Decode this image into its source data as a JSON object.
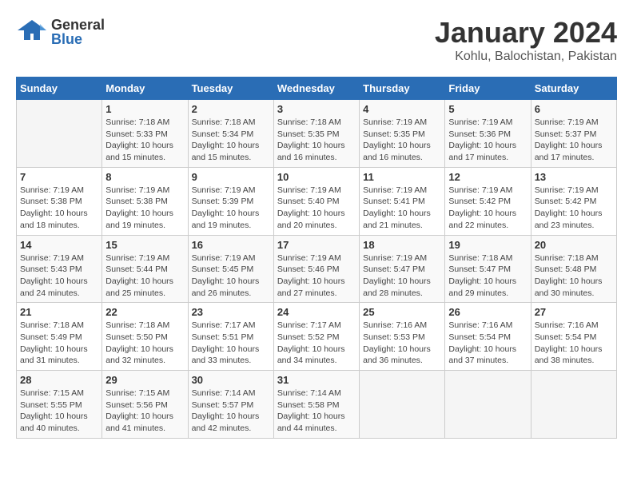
{
  "header": {
    "logo_general": "General",
    "logo_blue": "Blue",
    "main_title": "January 2024",
    "subtitle": "Kohlu, Balochistan, Pakistan"
  },
  "columns": [
    "Sunday",
    "Monday",
    "Tuesday",
    "Wednesday",
    "Thursday",
    "Friday",
    "Saturday"
  ],
  "weeks": [
    [
      {
        "day": "",
        "content": ""
      },
      {
        "day": "1",
        "content": "Sunrise: 7:18 AM\nSunset: 5:33 PM\nDaylight: 10 hours and 15 minutes."
      },
      {
        "day": "2",
        "content": "Sunrise: 7:18 AM\nSunset: 5:34 PM\nDaylight: 10 hours and 15 minutes."
      },
      {
        "day": "3",
        "content": "Sunrise: 7:18 AM\nSunset: 5:35 PM\nDaylight: 10 hours and 16 minutes."
      },
      {
        "day": "4",
        "content": "Sunrise: 7:19 AM\nSunset: 5:35 PM\nDaylight: 10 hours and 16 minutes."
      },
      {
        "day": "5",
        "content": "Sunrise: 7:19 AM\nSunset: 5:36 PM\nDaylight: 10 hours and 17 minutes."
      },
      {
        "day": "6",
        "content": "Sunrise: 7:19 AM\nSunset: 5:37 PM\nDaylight: 10 hours and 17 minutes."
      }
    ],
    [
      {
        "day": "7",
        "content": "Sunrise: 7:19 AM\nSunset: 5:38 PM\nDaylight: 10 hours and 18 minutes."
      },
      {
        "day": "8",
        "content": "Sunrise: 7:19 AM\nSunset: 5:38 PM\nDaylight: 10 hours and 19 minutes."
      },
      {
        "day": "9",
        "content": "Sunrise: 7:19 AM\nSunset: 5:39 PM\nDaylight: 10 hours and 19 minutes."
      },
      {
        "day": "10",
        "content": "Sunrise: 7:19 AM\nSunset: 5:40 PM\nDaylight: 10 hours and 20 minutes."
      },
      {
        "day": "11",
        "content": "Sunrise: 7:19 AM\nSunset: 5:41 PM\nDaylight: 10 hours and 21 minutes."
      },
      {
        "day": "12",
        "content": "Sunrise: 7:19 AM\nSunset: 5:42 PM\nDaylight: 10 hours and 22 minutes."
      },
      {
        "day": "13",
        "content": "Sunrise: 7:19 AM\nSunset: 5:42 PM\nDaylight: 10 hours and 23 minutes."
      }
    ],
    [
      {
        "day": "14",
        "content": "Sunrise: 7:19 AM\nSunset: 5:43 PM\nDaylight: 10 hours and 24 minutes."
      },
      {
        "day": "15",
        "content": "Sunrise: 7:19 AM\nSunset: 5:44 PM\nDaylight: 10 hours and 25 minutes."
      },
      {
        "day": "16",
        "content": "Sunrise: 7:19 AM\nSunset: 5:45 PM\nDaylight: 10 hours and 26 minutes."
      },
      {
        "day": "17",
        "content": "Sunrise: 7:19 AM\nSunset: 5:46 PM\nDaylight: 10 hours and 27 minutes."
      },
      {
        "day": "18",
        "content": "Sunrise: 7:19 AM\nSunset: 5:47 PM\nDaylight: 10 hours and 28 minutes."
      },
      {
        "day": "19",
        "content": "Sunrise: 7:18 AM\nSunset: 5:47 PM\nDaylight: 10 hours and 29 minutes."
      },
      {
        "day": "20",
        "content": "Sunrise: 7:18 AM\nSunset: 5:48 PM\nDaylight: 10 hours and 30 minutes."
      }
    ],
    [
      {
        "day": "21",
        "content": "Sunrise: 7:18 AM\nSunset: 5:49 PM\nDaylight: 10 hours and 31 minutes."
      },
      {
        "day": "22",
        "content": "Sunrise: 7:18 AM\nSunset: 5:50 PM\nDaylight: 10 hours and 32 minutes."
      },
      {
        "day": "23",
        "content": "Sunrise: 7:17 AM\nSunset: 5:51 PM\nDaylight: 10 hours and 33 minutes."
      },
      {
        "day": "24",
        "content": "Sunrise: 7:17 AM\nSunset: 5:52 PM\nDaylight: 10 hours and 34 minutes."
      },
      {
        "day": "25",
        "content": "Sunrise: 7:16 AM\nSunset: 5:53 PM\nDaylight: 10 hours and 36 minutes."
      },
      {
        "day": "26",
        "content": "Sunrise: 7:16 AM\nSunset: 5:54 PM\nDaylight: 10 hours and 37 minutes."
      },
      {
        "day": "27",
        "content": "Sunrise: 7:16 AM\nSunset: 5:54 PM\nDaylight: 10 hours and 38 minutes."
      }
    ],
    [
      {
        "day": "28",
        "content": "Sunrise: 7:15 AM\nSunset: 5:55 PM\nDaylight: 10 hours and 40 minutes."
      },
      {
        "day": "29",
        "content": "Sunrise: 7:15 AM\nSunset: 5:56 PM\nDaylight: 10 hours and 41 minutes."
      },
      {
        "day": "30",
        "content": "Sunrise: 7:14 AM\nSunset: 5:57 PM\nDaylight: 10 hours and 42 minutes."
      },
      {
        "day": "31",
        "content": "Sunrise: 7:14 AM\nSunset: 5:58 PM\nDaylight: 10 hours and 44 minutes."
      },
      {
        "day": "",
        "content": ""
      },
      {
        "day": "",
        "content": ""
      },
      {
        "day": "",
        "content": ""
      }
    ]
  ]
}
